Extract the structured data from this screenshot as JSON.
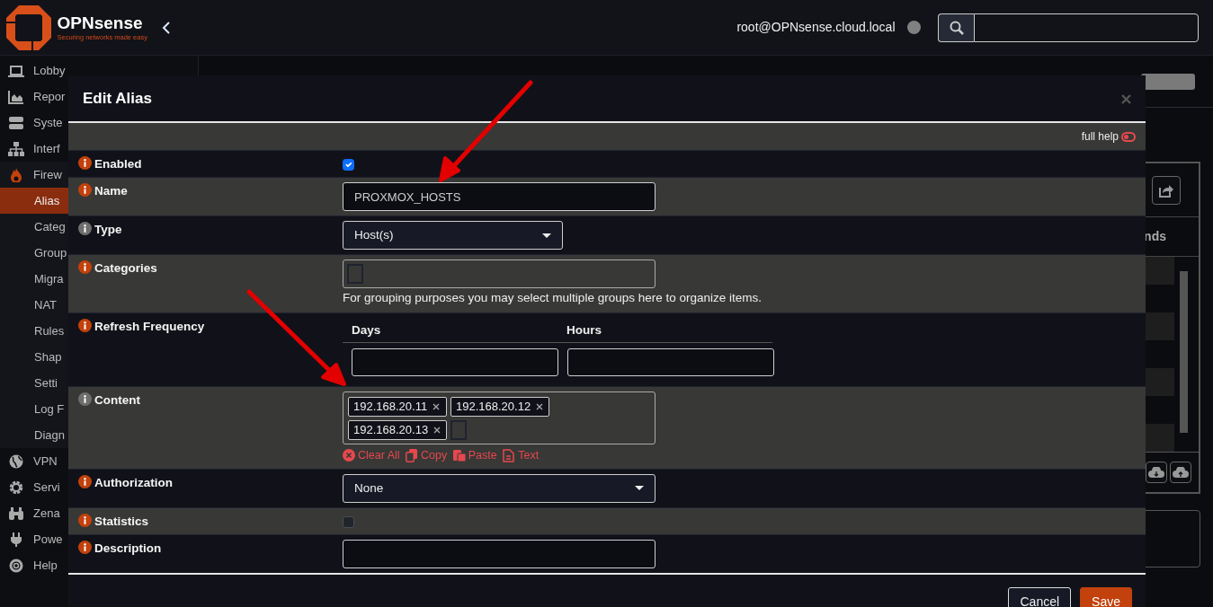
{
  "header": {
    "brand": "OPNsense",
    "tagline": "Securing networks made easy",
    "user": "root@OPNsense.cloud.local"
  },
  "sidebar": {
    "items": [
      {
        "label": "Lobby"
      },
      {
        "label": "Repor"
      },
      {
        "label": "Syste"
      },
      {
        "label": "Interf"
      },
      {
        "label": "Firew",
        "children": [
          {
            "label": "Alias",
            "selected": true
          },
          {
            "label": "Categ",
            "selected": false
          },
          {
            "label": "Group",
            "selected": false
          },
          {
            "label": "Migra",
            "selected": false
          },
          {
            "label": "NAT",
            "selected": false
          },
          {
            "label": "Rules",
            "selected": false
          },
          {
            "label": "Shap",
            "selected": false
          },
          {
            "label": "Setti",
            "selected": false
          },
          {
            "label": "Log F",
            "selected": false
          },
          {
            "label": "Diagn",
            "selected": false
          }
        ]
      },
      {
        "label": "VPN"
      },
      {
        "label": "Servi"
      },
      {
        "label": "Zena"
      },
      {
        "label": "Powe"
      },
      {
        "label": "Help"
      }
    ]
  },
  "background_table": {
    "column_header": "nds"
  },
  "modal": {
    "title": "Edit Alias",
    "full_help": {
      "label": "full help",
      "on": false
    },
    "fields": [
      {
        "kind": "checkbox",
        "label": "Enabled",
        "has_help": true,
        "checked": true
      },
      {
        "kind": "text",
        "label": "Name",
        "has_help": true,
        "value": "PROXMOX_HOSTS"
      },
      {
        "kind": "select",
        "label": "Type",
        "has_help": false,
        "value": "Host(s)"
      },
      {
        "kind": "tags",
        "label": "Categories",
        "has_help": true,
        "hint": "For grouping purposes you may select multiple groups here to organize items."
      },
      {
        "kind": "pair",
        "label": "Refresh Frequency",
        "has_help": true,
        "columns": [
          "Days",
          "Hours"
        ]
      },
      {
        "kind": "tokens",
        "label": "Content",
        "has_help": false,
        "tokens": [
          "192.168.20.11",
          "192.168.20.12",
          "192.168.20.13"
        ],
        "actions": [
          "Clear All",
          "Copy",
          "Paste",
          "Text"
        ]
      },
      {
        "kind": "select",
        "label": "Authorization",
        "has_help": true,
        "value": "None"
      },
      {
        "kind": "checkbox",
        "label": "Statistics",
        "has_help": true,
        "checked": false
      },
      {
        "kind": "text",
        "label": "Description",
        "has_help": true
      }
    ],
    "buttons": [
      {
        "label": "Cancel",
        "kind": "secondary"
      },
      {
        "label": "Save",
        "kind": "primary"
      }
    ]
  }
}
